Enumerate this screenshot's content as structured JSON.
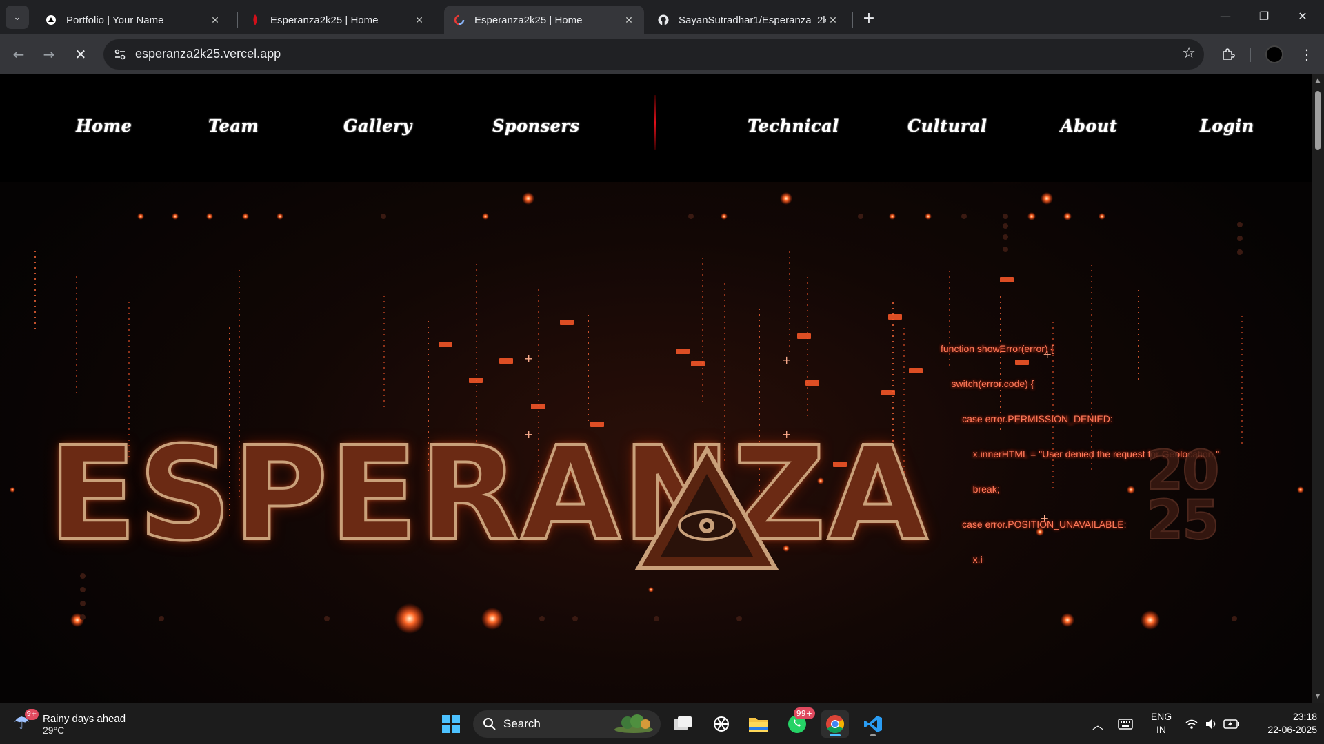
{
  "browser": {
    "tabs": [
      {
        "title": "Portfolio | Your Name",
        "active": false
      },
      {
        "title": "Esperanza2k25 | Home",
        "active": false
      },
      {
        "title": "Esperanza2k25 | Home",
        "active": true
      },
      {
        "title": "SayanSutradhar1/Esperanza_2k",
        "active": false
      }
    ],
    "url": "esperanza2k25.vercel.app"
  },
  "site": {
    "nav_left": [
      "Home",
      "Team",
      "Gallery",
      "Sponsers"
    ],
    "nav_right": [
      "Technical",
      "Cultural",
      "About",
      "Login"
    ],
    "brand": "ESPERANZA",
    "year_top": "20",
    "year_bottom": "25",
    "code_lines": [
      "function showError(error) {",
      "    switch(error.code) {",
      "        case error.PERMISSION_DENIED:",
      "            x.innerHTML = \"User denied the request for Geolocation.\"",
      "            break;",
      "        case error.POSITION_UNAVAILABLE:",
      "            x.i"
    ]
  },
  "taskbar": {
    "weather_badge": "9+",
    "weather_title": "Rainy days ahead",
    "weather_temp": "29°C",
    "search_label": "Search",
    "whatsapp_badge": "99+",
    "lang_top": "ENG",
    "lang_bottom": "IN",
    "time": "23:18",
    "date": "22-06-2025"
  },
  "colors": {
    "accent": "#ff4a2a",
    "brand_fill": "#6b2a14",
    "brand_outline": "#c9a07a",
    "divider": "#e0101a"
  }
}
